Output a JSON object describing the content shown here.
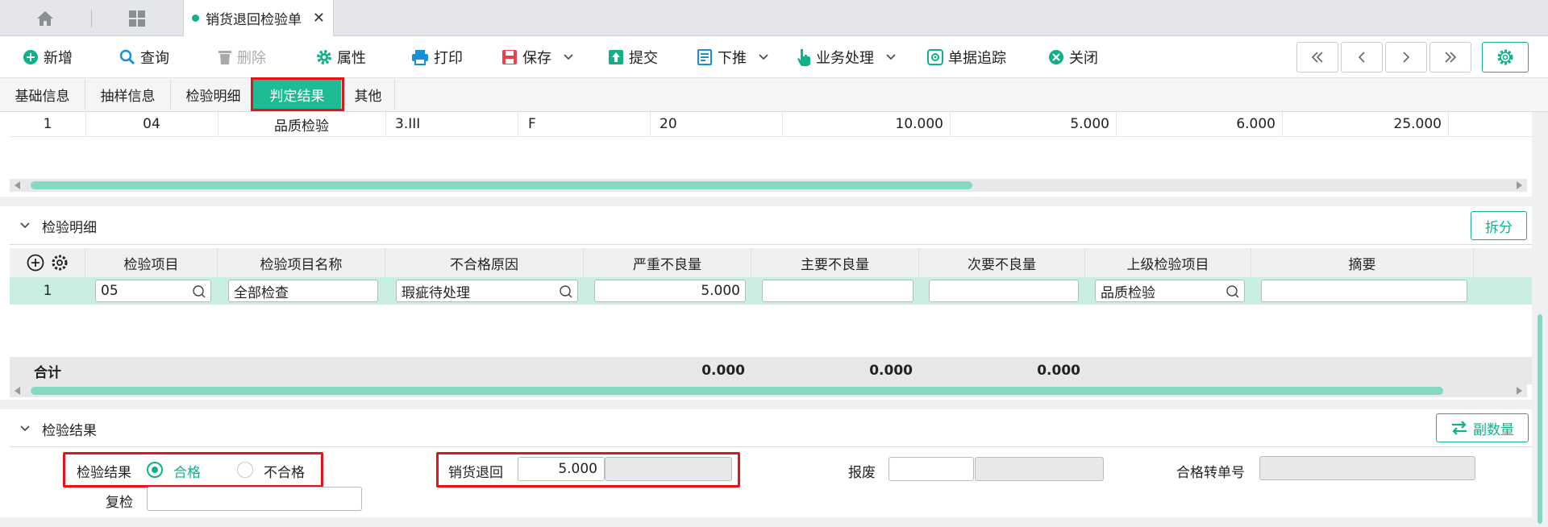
{
  "topbar": {
    "doc_tab_title": "销货退回检验单",
    "close_glyph": "✕"
  },
  "toolbar": {
    "new": "新增",
    "query": "查询",
    "delete": "删除",
    "properties": "属性",
    "print": "打印",
    "save": "保存",
    "submit": "提交",
    "push_down": "下推",
    "business": "业务处理",
    "trace": "单据追踪",
    "close": "关闭"
  },
  "subtabs": [
    "基础信息",
    "抽样信息",
    "检验明细",
    "判定结果",
    "其他"
  ],
  "top_table_row": {
    "seq": "1",
    "code": "04",
    "name": "品质检验",
    "level": "3.III",
    "aql": "F",
    "sample": "20",
    "v1": "10.000",
    "v2": "5.000",
    "v3": "6.000",
    "v4": "25.000"
  },
  "detail_section": {
    "title": "检验明细",
    "split_button": "拆分",
    "headers": [
      "检验项目",
      "检验项目名称",
      "不合格原因",
      "严重不良量",
      "主要不良量",
      "次要不良量",
      "上级检验项目",
      "摘要"
    ],
    "row": {
      "seq": "1",
      "item": "05",
      "item_name": "全部检查",
      "reason": "瑕疵待处理",
      "severe": "5.000",
      "major": "",
      "minor": "",
      "parent": "品质检验",
      "summary": ""
    },
    "total_label": "合计",
    "totals": {
      "severe": "0.000",
      "major": "0.000",
      "minor": "0.000"
    }
  },
  "result_section": {
    "title": "检验结果",
    "subqty_button": "副数量",
    "result_label": "检验结果",
    "pass_label": "合格",
    "fail_label": "不合格",
    "selected": "合格",
    "return_label": "销货退回",
    "return_value": "5.000",
    "scrap_label": "报废",
    "scrap_value": "",
    "transfer_label": "合格转单号",
    "transfer_value": "",
    "recheck_label": "复检",
    "recheck_value": ""
  },
  "colors": {
    "accent": "#12b08a",
    "active_tab": "#1ebc94",
    "highlight_border": "#e8131a",
    "selected_row": "#c8efe2"
  }
}
